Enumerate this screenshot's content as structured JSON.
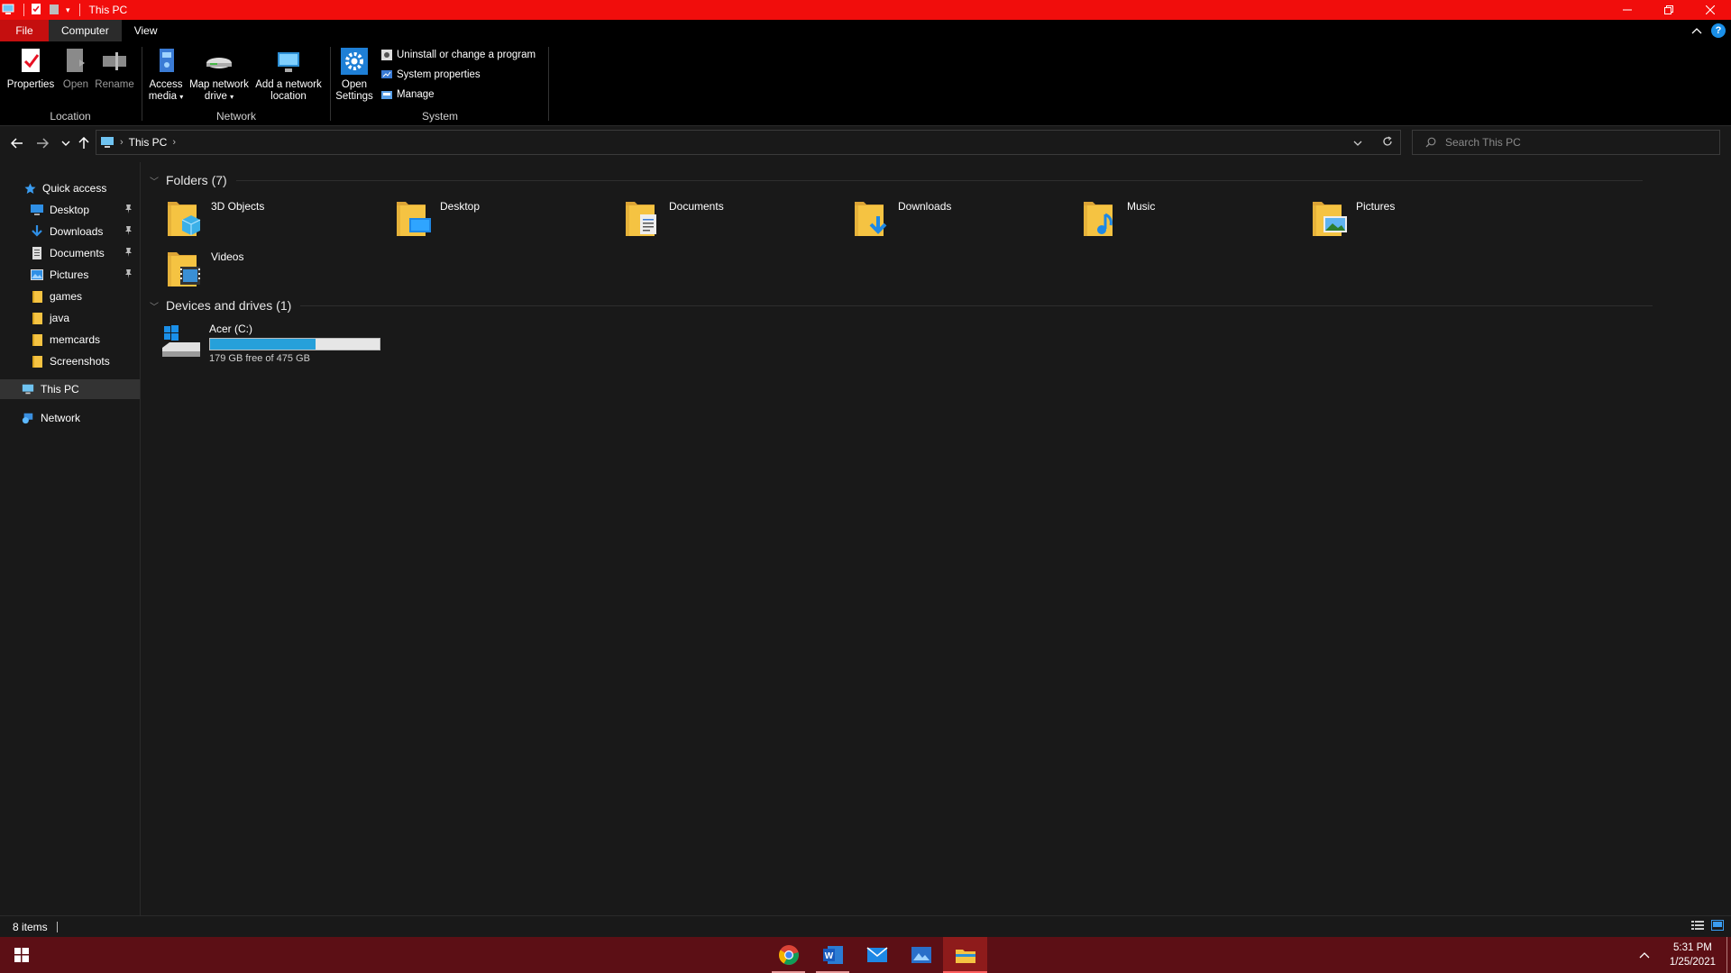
{
  "window": {
    "title": "This PC"
  },
  "ribbon": {
    "tabs": [
      {
        "label": "File"
      },
      {
        "label": "Computer"
      },
      {
        "label": "View"
      }
    ],
    "groups": {
      "location": {
        "label": "Location",
        "properties": "Properties",
        "open": "Open",
        "rename": "Rename"
      },
      "network": {
        "label": "Network",
        "access_media": [
          "Access",
          "media"
        ],
        "map_drive": [
          "Map network",
          "drive"
        ],
        "add_location": [
          "Add a network",
          "location"
        ]
      },
      "system": {
        "label": "System",
        "open_settings": [
          "Open",
          "Settings"
        ],
        "uninstall": "Uninstall or change a program",
        "system_properties": "System properties",
        "manage": "Manage"
      }
    }
  },
  "address": {
    "crumb": "This PC",
    "search_placeholder": "Search This PC"
  },
  "navpane": {
    "quick_access": "Quick access",
    "items": [
      {
        "label": "Desktop",
        "icon": "desktop-icon",
        "pinned": true
      },
      {
        "label": "Downloads",
        "icon": "downloads-icon",
        "pinned": true
      },
      {
        "label": "Documents",
        "icon": "documents-icon",
        "pinned": true
      },
      {
        "label": "Pictures",
        "icon": "pictures-icon",
        "pinned": true
      },
      {
        "label": "games",
        "icon": "folder-icon",
        "pinned": false
      },
      {
        "label": "java",
        "icon": "folder-icon",
        "pinned": false
      },
      {
        "label": "memcards",
        "icon": "folder-icon",
        "pinned": false
      },
      {
        "label": "Screenshots",
        "icon": "folder-icon",
        "pinned": false
      }
    ],
    "this_pc": "This PC",
    "network": "Network"
  },
  "content": {
    "folders_header": "Folders (7)",
    "folders": [
      {
        "label": "3D Objects",
        "icon": "3d-objects-folder-icon"
      },
      {
        "label": "Desktop",
        "icon": "desktop-folder-icon"
      },
      {
        "label": "Documents",
        "icon": "documents-folder-icon"
      },
      {
        "label": "Downloads",
        "icon": "downloads-folder-icon"
      },
      {
        "label": "Music",
        "icon": "music-folder-icon"
      },
      {
        "label": "Pictures",
        "icon": "pictures-folder-icon"
      },
      {
        "label": "Videos",
        "icon": "videos-folder-icon"
      }
    ],
    "devices_header": "Devices and drives (1)",
    "drive": {
      "name": "Acer (C:)",
      "free_text": "179 GB free of 475 GB",
      "used_fraction": 0.623
    }
  },
  "status": {
    "item_count": "8 items"
  },
  "taskbar": {
    "apps": [
      "chrome-icon",
      "word-icon",
      "mail-icon",
      "photos-icon",
      "file-explorer-icon"
    ],
    "time": "5:31 PM",
    "date": "1/25/2021"
  },
  "colors": {
    "titlebar": "#f10d0c",
    "accent": "#26a0da",
    "taskbar": "#5c0f15"
  }
}
